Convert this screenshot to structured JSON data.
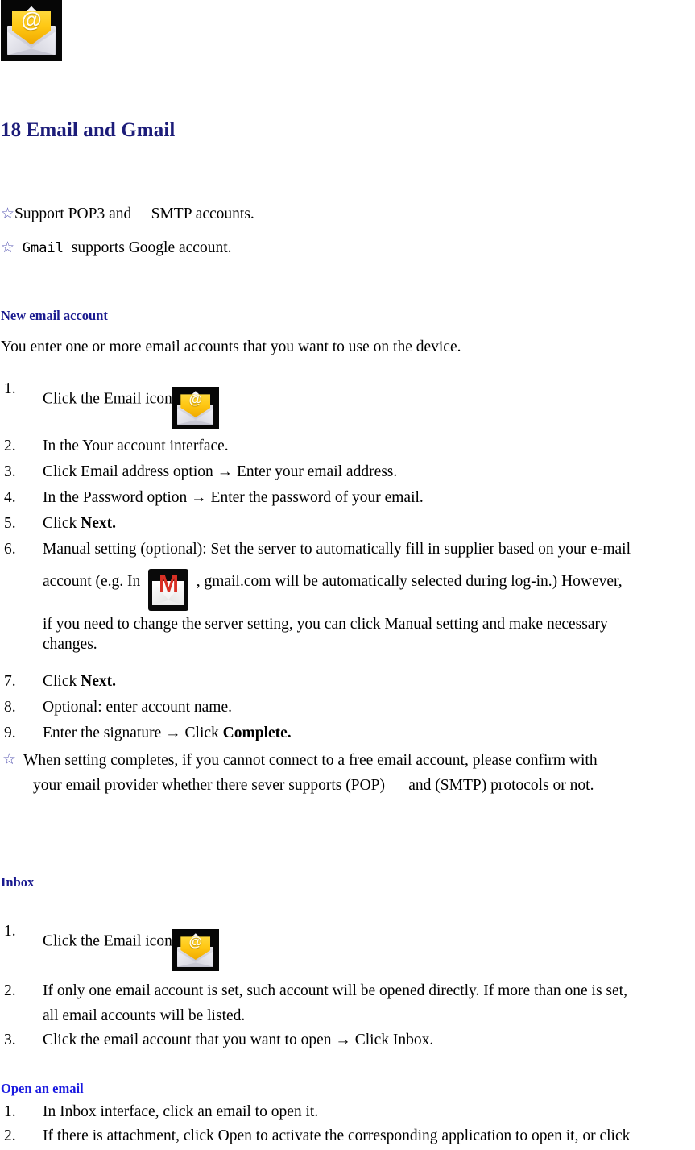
{
  "document": {
    "chapter_title": "18 Email and Gmail",
    "title_color": "#1c1c79",
    "heading_color": "#1a1a8f",
    "heading_bright_color": "#1919e0",
    "background": "#ffffff"
  },
  "icons": {
    "email_app": {
      "name": "email-app-icon",
      "glyph": "@",
      "tile_color": "#060606",
      "card_color": "#ffc814"
    },
    "gmail_app": {
      "name": "gmail-app-icon",
      "glyph": "M",
      "tile_color": "#0a0a0a",
      "m_color": "#d93025"
    },
    "star_bullet": "☆"
  },
  "intro": {
    "bullet_pop3": {
      "star": "☆",
      "text": "Support POP3 and  SMTP accounts."
    },
    "bullet_gmail": {
      "star": "☆",
      "mono_word": "Gmail",
      "text": "supports Google account."
    }
  },
  "sections": [
    {
      "id": "new-email-account",
      "heading": "New email account",
      "heading_style": "dark",
      "intro": "You enter one or more email accounts that you want to use on the device.",
      "steps": [
        {
          "num": "1.",
          "text": "Click the Email icon",
          "has_email_icon": true
        },
        {
          "num": "2.",
          "text": "In the Your account interface."
        },
        {
          "num": "3.",
          "text": "Click Email address option → Enter your email address."
        },
        {
          "num": "4.",
          "text": "In the Password option → Enter the password of your email."
        },
        {
          "num": "5.",
          "text": "Click ",
          "bold_tail": "Next."
        },
        {
          "num": "6.",
          "line1": "Manual setting (optional): Set the server to automatically fill in supplier based on your e-mail",
          "line2_pre": "account (e.g. In",
          "line2_post": ", gmail.com will be automatically selected during log-in.) However,",
          "has_gmail_icon": true,
          "line3": "if you need to change the server setting, you can click Manual setting and make necessary",
          "line4": "changes."
        },
        {
          "num": "7.",
          "text": "Click ",
          "bold_tail": "Next."
        },
        {
          "num": "8.",
          "text": "Optional: enter account name."
        },
        {
          "num": "9.",
          "text": "Enter the signature → Click ",
          "bold_tail": "Complete."
        }
      ],
      "note": {
        "star": "☆",
        "line1": "When setting completes, if you cannot connect to a free email account, please confirm with",
        "line2": "your email provider whether there sever supports (POP)  and (SMTP) protocols or not."
      }
    },
    {
      "id": "inbox",
      "heading": "Inbox",
      "heading_style": "dark",
      "steps": [
        {
          "num": "1.",
          "text": "Click the Email icon",
          "has_email_icon": true
        },
        {
          "num": "2.",
          "line1": "If only one email account is set, such account will be opened directly. If more than one is set,",
          "line2": "all email accounts will be listed."
        },
        {
          "num": "3.",
          "text": "Click the email account that you want to open → Click Inbox."
        }
      ]
    },
    {
      "id": "open-an-email",
      "heading": "Open an email",
      "heading_style": "bright",
      "steps": [
        {
          "num": "1.",
          "text": "In Inbox interface, click an email to open it."
        },
        {
          "num": "2.",
          "text": "If there is attachment, click Open to activate the corresponding application to open it, or click"
        }
      ]
    }
  ]
}
